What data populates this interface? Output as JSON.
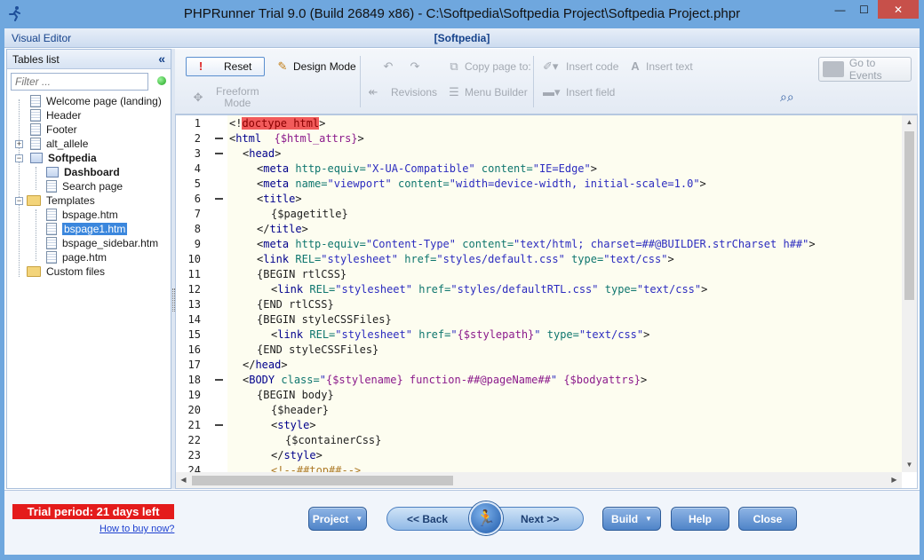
{
  "window": {
    "title": "PHPRunner Trial 9.0 (Build 26849 x86) - C:\\Softpedia\\Softpedia Project\\Softpedia Project.phpr",
    "minimize": "—",
    "maximize": "☐",
    "close": "✕"
  },
  "visual_editor": {
    "label": "Visual Editor",
    "project": "[Softpedia]"
  },
  "tables_list": {
    "title": "Tables list",
    "collapse": "«",
    "filter_placeholder": "Filter ...",
    "items": [
      {
        "label": "Welcome page (landing)"
      },
      {
        "label": "Header"
      },
      {
        "label": "Footer"
      },
      {
        "label": "alt_allele"
      },
      {
        "label": "Softpedia"
      },
      {
        "label": "Dashboard"
      },
      {
        "label": "Search page"
      },
      {
        "label": "Templates"
      },
      {
        "label": "bspage.htm"
      },
      {
        "label": "bspage1.htm"
      },
      {
        "label": "bspage_sidebar.htm"
      },
      {
        "label": "page.htm"
      },
      {
        "label": "Custom files"
      }
    ]
  },
  "toolbar": {
    "reset": "Reset",
    "design_mode": "Design Mode",
    "freeform_mode": "Freeform",
    "freeform_mode2": "Mode",
    "copy_page": "Copy page to:",
    "revisions": "Revisions",
    "menu_builder": "Menu Builder",
    "insert_code": "Insert code",
    "insert_text": "Insert text",
    "insert_field": "Insert field",
    "go_to_events": "Go to Events"
  },
  "editor": {
    "line_numbers": [
      "1",
      "2",
      "3",
      "4",
      "5",
      "6",
      "7",
      "8",
      "9",
      "10",
      "11",
      "12",
      "13",
      "14",
      "15",
      "16",
      "17",
      "18",
      "19",
      "20",
      "21",
      "22",
      "23",
      "24"
    ]
  },
  "bottom": {
    "trial": "Trial period: 21 days left",
    "buy": "How to buy now?",
    "project": "Project",
    "back": "<< Back",
    "next": "Next >>",
    "build": "Build",
    "help": "Help",
    "close": "Close"
  },
  "colors": {
    "accent": "#6fa7de",
    "trial_bg": "#e41b1b",
    "selected": "#3b87dd"
  }
}
